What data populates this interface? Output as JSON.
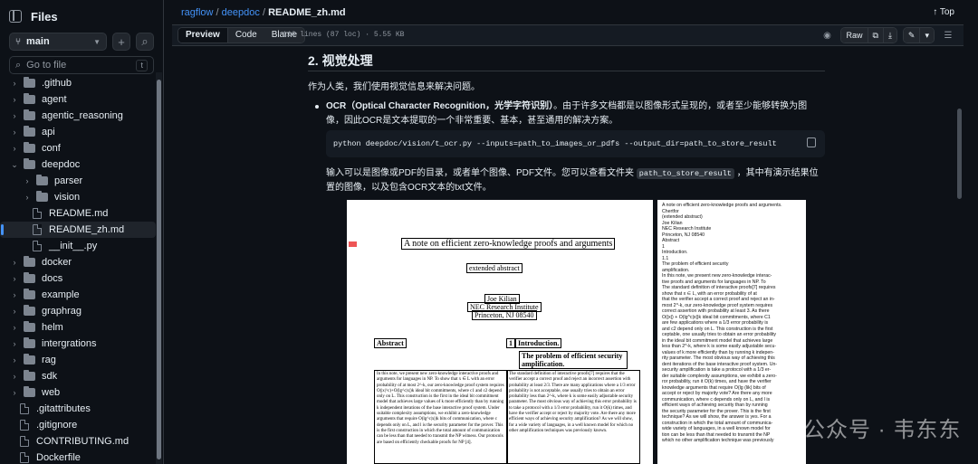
{
  "sidebar": {
    "title": "Files",
    "branch": "main",
    "goto_placeholder": "Go to file",
    "goto_shortcut": "t",
    "items": [
      {
        "label": ".github",
        "type": "folder"
      },
      {
        "label": "agent",
        "type": "folder"
      },
      {
        "label": "agentic_reasoning",
        "type": "folder"
      },
      {
        "label": "api",
        "type": "folder"
      },
      {
        "label": "conf",
        "type": "folder"
      },
      {
        "label": "deepdoc",
        "type": "folder-open"
      },
      {
        "label": "parser",
        "type": "folder"
      },
      {
        "label": "vision",
        "type": "folder"
      },
      {
        "label": "README.md",
        "type": "file"
      },
      {
        "label": "README_zh.md",
        "type": "file"
      },
      {
        "label": "__init__.py",
        "type": "file"
      },
      {
        "label": "docker",
        "type": "folder"
      },
      {
        "label": "docs",
        "type": "folder"
      },
      {
        "label": "example",
        "type": "folder"
      },
      {
        "label": "graphrag",
        "type": "folder"
      },
      {
        "label": "helm",
        "type": "folder"
      },
      {
        "label": "intergrations",
        "type": "folder"
      },
      {
        "label": "rag",
        "type": "folder"
      },
      {
        "label": "sdk",
        "type": "folder"
      },
      {
        "label": "web",
        "type": "folder"
      },
      {
        "label": ".gitattributes",
        "type": "file"
      },
      {
        "label": ".gitignore",
        "type": "file"
      },
      {
        "label": "CONTRIBUTING.md",
        "type": "file"
      },
      {
        "label": "Dockerfile",
        "type": "file"
      }
    ]
  },
  "header": {
    "crumb_repo": "ragflow",
    "crumb_dir": "deepdoc",
    "crumb_file": "README_zh.md",
    "top_label": "Top"
  },
  "toolbar": {
    "tabs": [
      "Preview",
      "Code",
      "Blame"
    ],
    "meta": "116 lines (87 loc) · 5.55 KB",
    "raw_label": "Raw"
  },
  "content": {
    "heading": "2. 视觉处理",
    "intro": "作为人类，我们使用视觉信息来解决问题。",
    "ocr_title": "OCR（Optical Character Recognition，光学字符识别）",
    "ocr_text": "。由于许多文档都是以图像形式呈现的，或者至少能够转换为图像，因此OCR是文本提取的一个非常重要、基本，甚至通用的解决方案。",
    "command": "python deepdoc/vision/t_ocr.py --inputs=path_to_images_or_pdfs --output_dir=path_to_store_result",
    "desc_before": "输入可以是图像或PDF的目录，或者单个图像、PDF文件。您可以查看文件夹 ",
    "desc_code": "path_to_store_result",
    "desc_after": " ，其中有演示结果位置的图像，以及包含OCR文本的txt文件。"
  },
  "figure": {
    "title": "A note on efficient zero-knowledge proofs and arguments",
    "subtitle": "extended abstract",
    "author": "Joe Kilian",
    "affil1": "NEC Research Institute",
    "affil2": "Princeton, NJ 08540",
    "abstract": "Abstract",
    "section_num": "1",
    "section": "Introduction.",
    "subsection": "The problem of efficient security amplification.",
    "abstract_text": "In this note, we present new zero-knowledge interactive proofs and arguments for languages in NP. To show that x ∈ L with an error probability of at most 2^-k, our zero-knowledge proof system requires O(|x|^c)+O(lg^c|x|)k ideal bit commitments, where c1 and c2 depend only on L. This construction is the first in the ideal bit commitment model that achieves large values of k more efficiently than by running k independent iterations of the base interactive proof system. Under suitable complexity assumptions, we exhibit a zero-knowledge arguments that require O(lg^c|x|)k bits of communication, where c depends only on L, and l is the security parameter for the prover. This is the first construction in which the total amount of communication can be less than that needed to transmit the NP witness. Our protocols are based on efficiently checkable proofs for NP [4].",
    "intro_text": "The standard definition of interactive proofs[7] requires that the verifier accept a correct proof and reject an incorrect assertion with probability at least 2/3. There are many applications where a 1/3 error probability is not acceptable, one usually tries to obtain an error probability less than 2^-k, where k is some easily adjustable security parameter. The most obvious way of achieving this error probability is to take a protocol with a 1/3 error probability, run it O(k) times, and have the verifier accept or reject by majority vote. Are there any more efficient ways of achieving security amplification? As we will show, for a wide variety of languages, in a well known model for which no other amplification techniques was previously known.",
    "ocr_lines": [
      "A note on efficient zero-knowledge proofs and arguments.",
      "Chertfor",
      "(extended abstract)",
      "Joe Kilian",
      "NEC Research Institute",
      "Princeton, NJ 08540",
      "Abstract",
      "1",
      "Introduction.",
      "1.1",
      "The problem of efficient security",
      "amplification.",
      "In this note, we present new zero-knowledge interac-",
      "tive proofs and arguments for languages in NP. To",
      "The standard definition of interactive proofs[7] requires",
      "show that x ∈ L, with an error probability of at",
      "that the verifier accept a correct proof and reject an in-",
      "most 2^-k, our zero-knowledge proof system requires",
      "correct assertion with probability at least 3. As there",
      "O(|x|) + O(lg^c|x|)k ideal bit commitments, where C1",
      "are few applications where a 1/3 error probability is",
      "and c2 depend only on L. This construction is the first",
      "ceptable, one usually tries to obtain an error probability",
      "in the ideal bit commitment model that achieves large",
      "less than 2^-k, where k is some easily adjustable secu-",
      "values of k more efficiently than by running k indepen-",
      "rity parameter. The most obvious way of achieving this",
      "dent iterations of the base interactive proof system. Un-",
      "security amplification is take a protocol with a 1/3 er-",
      "der suitable complexity assumptions, we exhibit a zero-",
      "ror probability, run it O(k) times, and have the verifier",
      "knowledge arguments that require O(lg (lik) bits of",
      "accept or reject by majority vote? Are there any more",
      "communication, where c depends only on L, and l is",
      "efficient ways of achieving security than by running",
      "the security parameter for the prover. This is the first",
      "technique? As we will show, the answer is yes. For a",
      "construction in which the total amount of communica-",
      "wide variety of languages, in a well known model for",
      "tion can be less than that needed to transmit the NP",
      "which no other amplification technique was previously"
    ]
  },
  "watermark": "公众号 · 韦东东",
  "colors": {
    "background": "#0d1117",
    "accent": "#4493f8",
    "border": "#30363d"
  }
}
